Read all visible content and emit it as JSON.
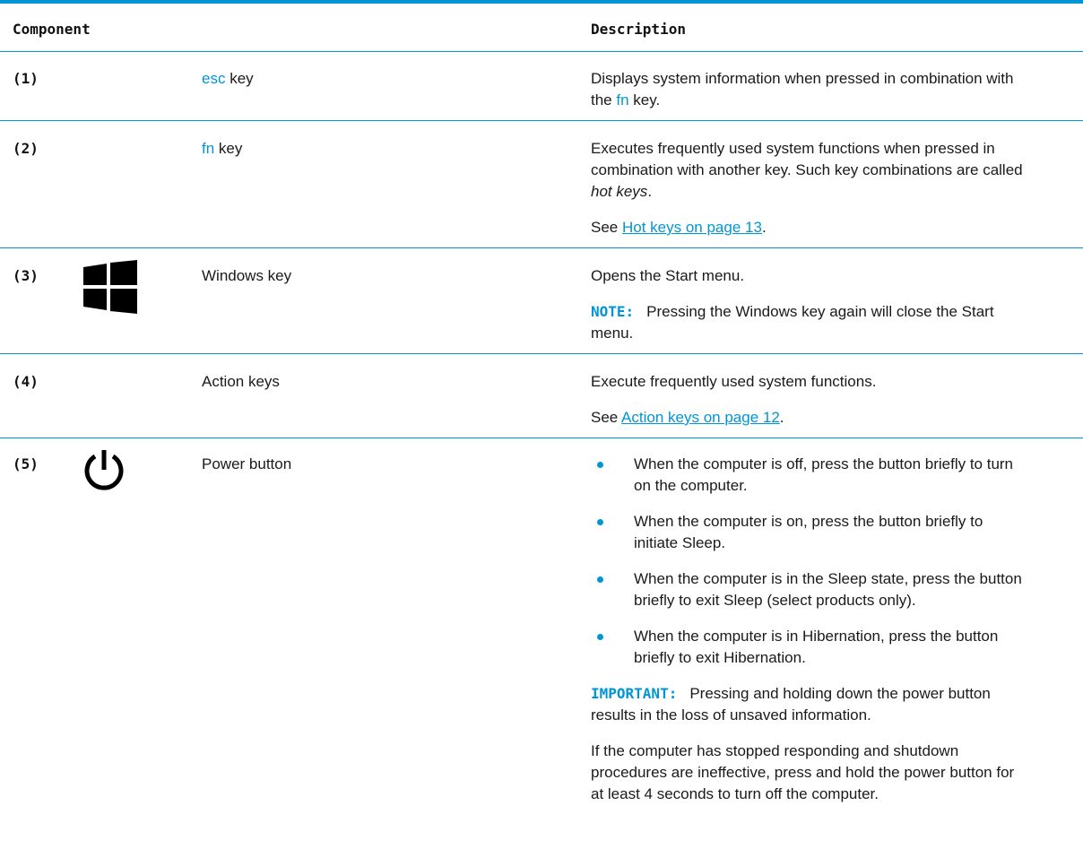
{
  "header": {
    "component": "Component",
    "description": "Description"
  },
  "rows": [
    {
      "num": "(1)",
      "key_word": "esc",
      "key_suffix": " key",
      "desc_a": "Displays system information when pressed in combination with",
      "desc_b_pre": "the ",
      "desc_b_key": "fn",
      "desc_b_post": " key."
    },
    {
      "num": "(2)",
      "key_word": "fn",
      "key_suffix": " key",
      "desc_a": "Executes frequently used system functions when pressed in",
      "desc_b": "combination with another key. Such key combinations are called",
      "desc_c": "hot keys",
      "desc_c_post": ".",
      "see_pre": "See ",
      "see_link": "Hot keys on page 13",
      "see_post": "."
    },
    {
      "num": "(3)",
      "icon": "windows-logo-icon",
      "name": "Windows key",
      "desc": "Opens the Start menu.",
      "note_label": "NOTE:",
      "note_a": "Pressing the Windows key again will close the Start",
      "note_b": "menu."
    },
    {
      "num": "(4)",
      "name": "Action keys",
      "desc": "Execute frequently used system functions.",
      "see_pre": "See ",
      "see_link": "Action keys on page 12",
      "see_post": "."
    },
    {
      "num": "(5)",
      "icon": "power-icon",
      "name": "Power button",
      "bullets": [
        {
          "a": "When the computer is off, press the button briefly to turn",
          "b": "on the computer."
        },
        {
          "a": "When the computer is on, press the button briefly to",
          "b": "initiate Sleep."
        },
        {
          "a": "When the computer is in the Sleep state, press the button",
          "b": "briefly to exit Sleep (select products only)."
        },
        {
          "a": "When the computer is in Hibernation, press the button",
          "b": "briefly to exit Hibernation."
        }
      ],
      "important_label": "IMPORTANT:",
      "important_a": "Pressing and holding down the power button",
      "important_b": "results in the loss of unsaved information.",
      "final_a": "If the computer has stopped responding and shutdown",
      "final_b": "procedures are ineffective, press and hold the power button for",
      "final_c": "at least 4 seconds to turn off the computer."
    }
  ],
  "colors": {
    "accent": "#0096d6",
    "text": "#1a1a1a"
  }
}
